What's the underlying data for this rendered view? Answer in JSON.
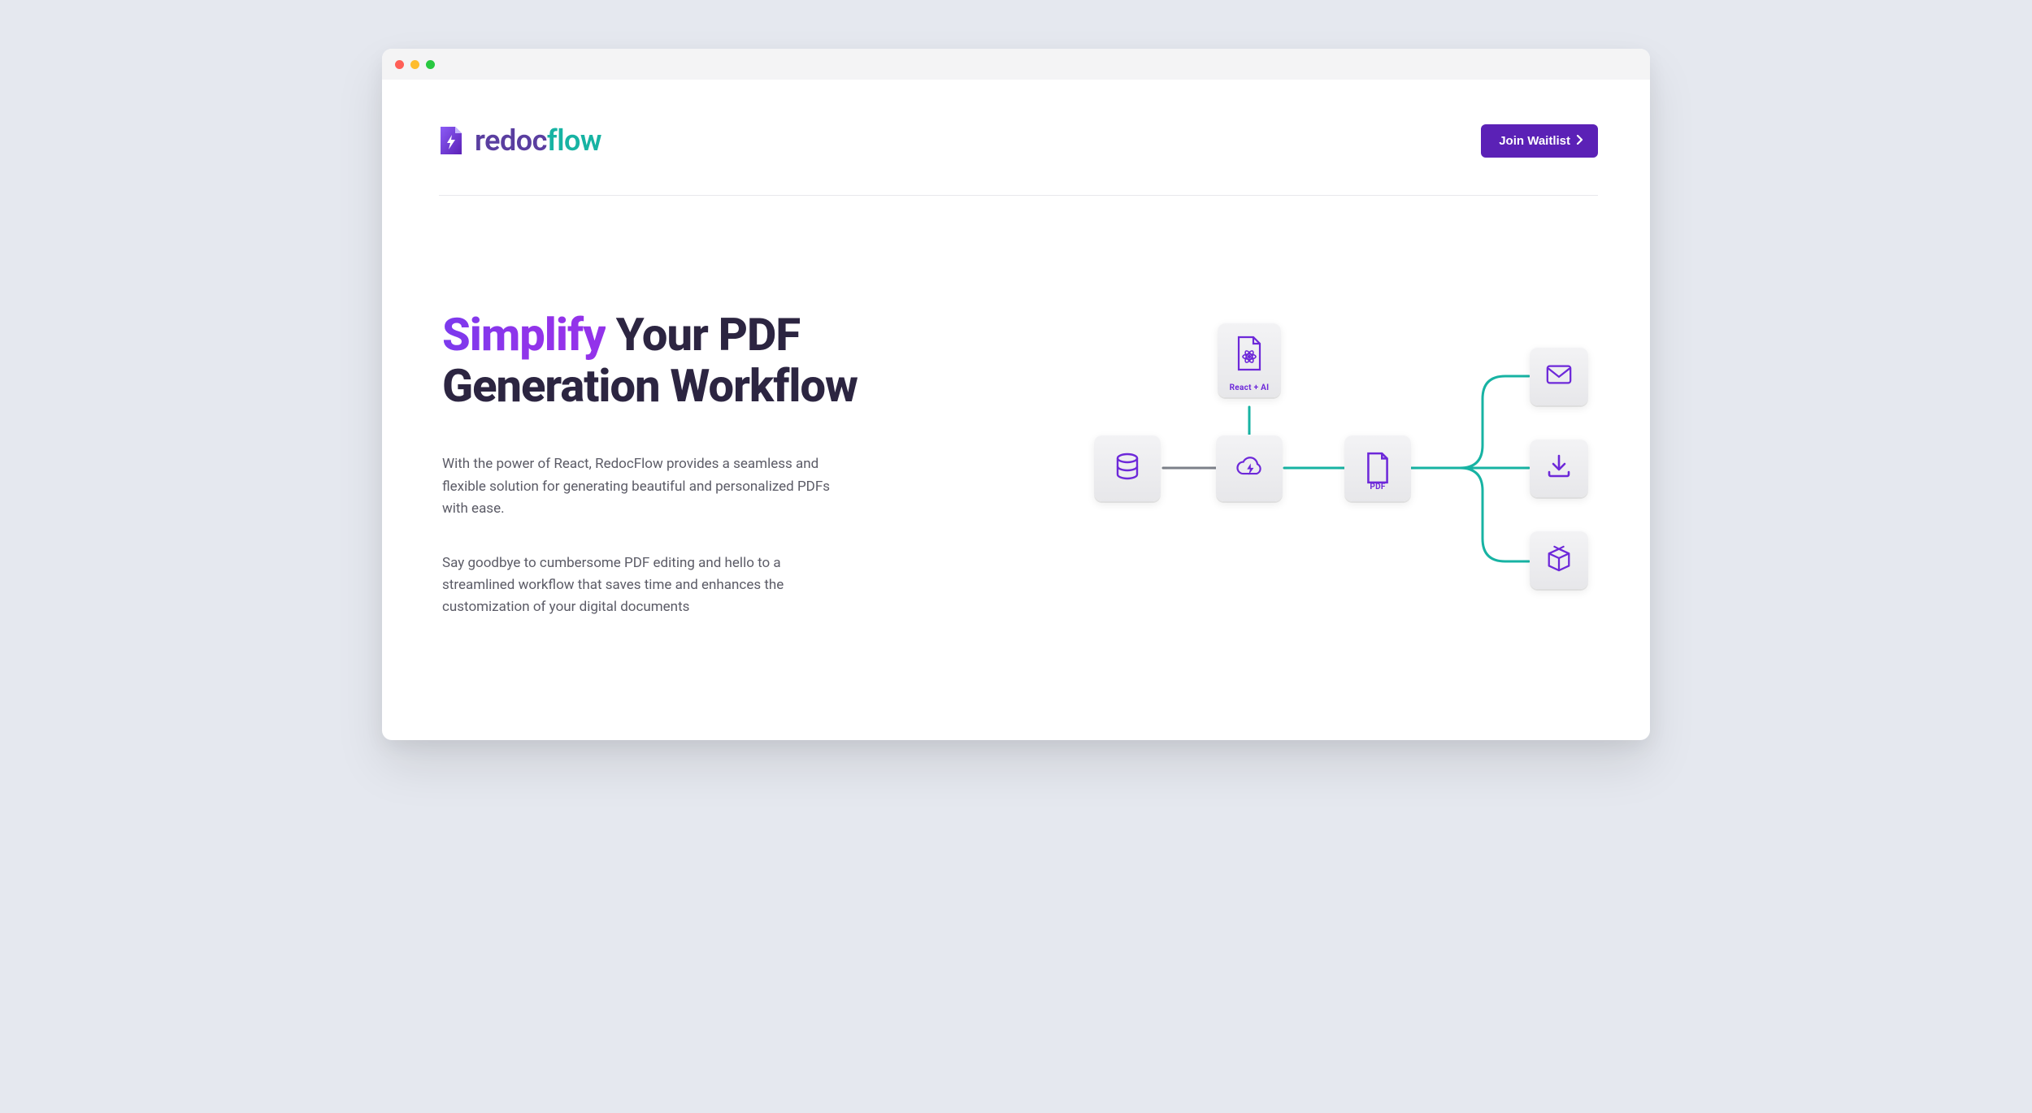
{
  "brand": {
    "name_a": "redoc",
    "name_b": "flow"
  },
  "header": {
    "cta_label": "Join Waitlist"
  },
  "hero": {
    "title_accent": "Simplify",
    "title_rest": "Your PDF Generation Workflow",
    "para1": "With the power of React, RedocFlow provides a seamless and flexible solution for generating beautiful and personalized PDFs with ease.",
    "para2": "Say goodbye to cumbersome PDF editing and hello to a streamlined workflow that saves time and enhances the customization of your digital documents"
  },
  "diagram": {
    "react_caption": "React + AI",
    "pdf_caption": "PDF"
  }
}
